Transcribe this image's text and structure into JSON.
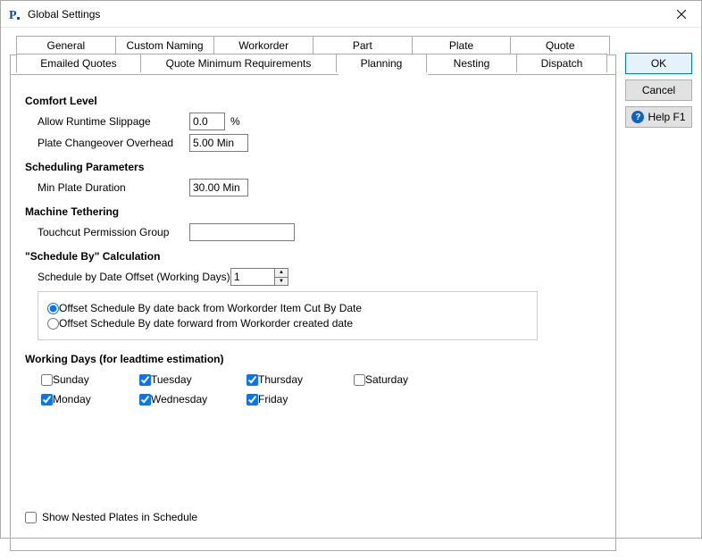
{
  "window": {
    "title": "Global Settings"
  },
  "tabs_row1": [
    "General",
    "Custom Naming",
    "Workorder",
    "Part",
    "Plate",
    "Quote"
  ],
  "tabs_row2": [
    "Emailed Quotes",
    "Quote Minimum Requirements",
    "Planning",
    "Nesting",
    "Dispatch"
  ],
  "active_tab": "Planning",
  "sections": {
    "comfort": {
      "title": "Comfort Level",
      "slippage_label": "Allow Runtime Slippage",
      "slippage_value": "0.0",
      "slippage_unit": "%",
      "changeover_label": "Plate Changeover Overhead",
      "changeover_value": "5.00 Min"
    },
    "scheduling": {
      "title": "Scheduling Parameters",
      "min_plate_label": "Min Plate Duration",
      "min_plate_value": "30.00 Min"
    },
    "tethering": {
      "title": "Machine Tethering",
      "perm_label": "Touchcut Permission Group",
      "perm_value": ""
    },
    "scheduleby": {
      "title": "\"Schedule By\" Calculation",
      "offset_label": "Schedule by Date Offset (Working Days)",
      "offset_value": "1",
      "radio1": "Offset Schedule By date back from Workorder Item Cut By Date",
      "radio2": "Offset Schedule By date forward from Workorder created date"
    },
    "workingdays": {
      "title": "Working Days (for leadtime estimation)",
      "days": {
        "sunday": {
          "label": "Sunday",
          "checked": false
        },
        "monday": {
          "label": "Monday",
          "checked": true
        },
        "tuesday": {
          "label": "Tuesday",
          "checked": true
        },
        "wednesday": {
          "label": "Wednesday",
          "checked": true
        },
        "thursday": {
          "label": "Thursday",
          "checked": true
        },
        "friday": {
          "label": "Friday",
          "checked": true
        },
        "saturday": {
          "label": "Saturday",
          "checked": false
        }
      }
    },
    "shownested": {
      "label": "Show Nested Plates in Schedule",
      "checked": false
    }
  },
  "buttons": {
    "ok": "OK",
    "cancel": "Cancel",
    "help": "Help F1"
  }
}
